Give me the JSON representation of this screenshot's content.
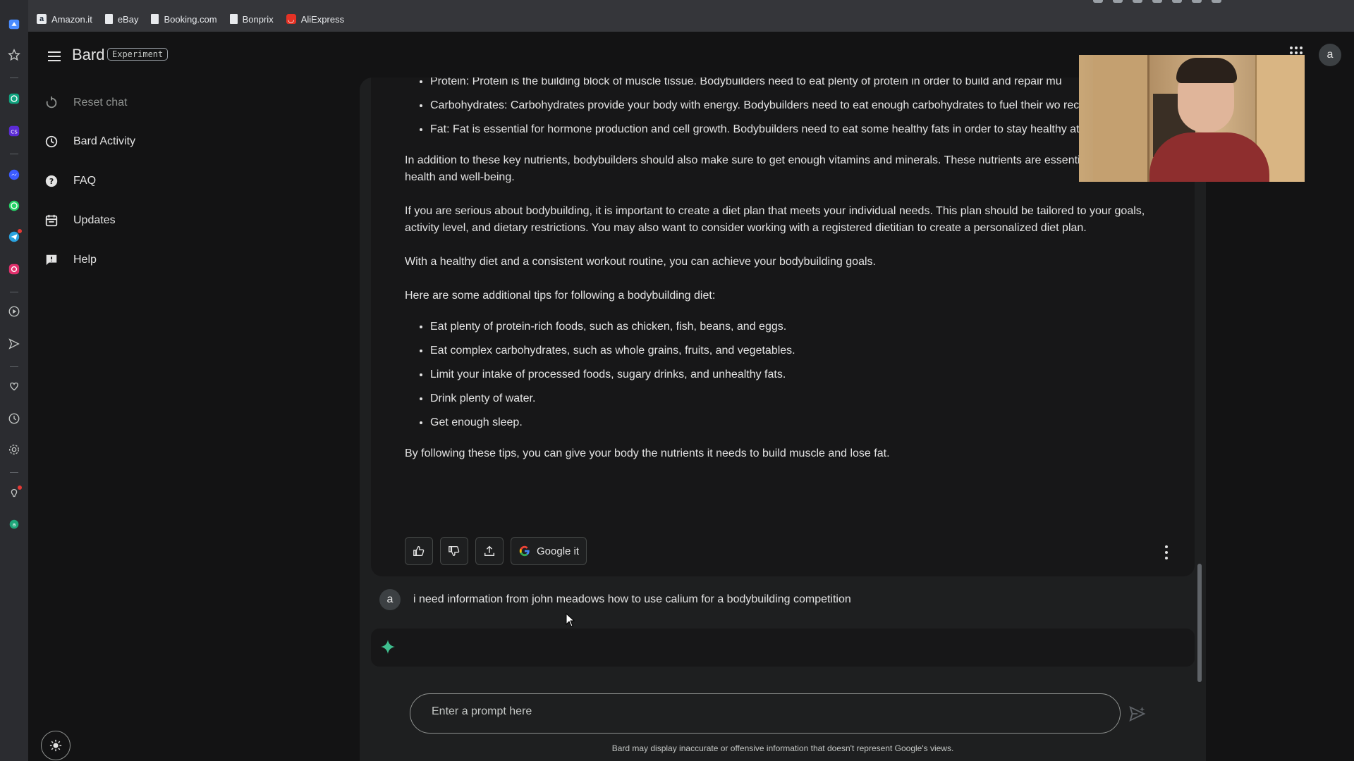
{
  "browser": {
    "bookmarks": [
      {
        "label": "Amazon.it",
        "icon": "amazon-icon"
      },
      {
        "label": "eBay",
        "icon": "page-icon"
      },
      {
        "label": "Booking.com",
        "icon": "page-icon"
      },
      {
        "label": "Bonprix",
        "icon": "page-icon"
      },
      {
        "label": "AliExpress",
        "icon": "aliexpress-icon"
      }
    ],
    "sidebar_icons": [
      "workspace-icon",
      "star-icon",
      "chatgpt-icon",
      "cs-icon",
      "messenger-icon",
      "whatsapp-icon",
      "telegram-icon",
      "instagram-icon",
      "player-icon",
      "send-icon",
      "heart-icon",
      "history-icon",
      "settings-icon",
      "tips-icon",
      "aria-icon"
    ]
  },
  "nav": {
    "logo": "Bard",
    "badge": "Experiment",
    "items": [
      {
        "label": "Reset chat",
        "icon": "reset-icon",
        "disabled": true
      },
      {
        "label": "Bard Activity",
        "icon": "history-icon"
      },
      {
        "label": "FAQ",
        "icon": "help-circle-icon"
      },
      {
        "label": "Updates",
        "icon": "calendar-icon"
      },
      {
        "label": "Help",
        "icon": "feedback-icon"
      }
    ]
  },
  "response": {
    "bullets_top": [
      "Protein: Protein is the building block of muscle tissue. Bodybuilders need to eat plenty of protein in order to build and repair mu",
      "Carbohydrates: Carbohydrates provide your body with energy. Bodybuilders need to eat enough carbohydrates to fuel their wo recover from them.",
      "Fat: Fat is essential for hormone production and cell growth. Bodybuilders need to eat some healthy fats in order to stay healthy at their best."
    ],
    "p1": "In addition to these key nutrients, bodybuilders should also make sure to get enough vitamins and minerals. These nutrients are essential for overall health and well-being.",
    "p2": "If you are serious about bodybuilding, it is important to create a diet plan that meets your individual needs. This plan should be tailored to your goals, activity level, and dietary restrictions. You may also want to consider working with a registered dietitian to create a personalized diet plan.",
    "p3": "With a healthy diet and a consistent workout routine, you can achieve your bodybuilding goals.",
    "p4": "Here are some additional tips for following a bodybuilding diet:",
    "tips": [
      "Eat plenty of protein-rich foods, such as chicken, fish, beans, and eggs.",
      "Eat complex carbohydrates, such as whole grains, fruits, and vegetables.",
      "Limit your intake of processed foods, sugary drinks, and unhealthy fats.",
      "Drink plenty of water.",
      "Get enough sleep."
    ],
    "p5": "By following these tips, you can give your body the nutrients it needs to build muscle and lose fat.",
    "google_it": "Google it"
  },
  "user": {
    "avatar": "a",
    "message": "i need information from john meadows how to use calium for a bodybuilding competition"
  },
  "prompt": {
    "placeholder": "Enter a prompt here",
    "disclaimer": "Bard may display inaccurate or offensive information that doesn't represent Google's views."
  },
  "account": {
    "initial": "a"
  },
  "colors": {
    "background": "#131314",
    "panel": "#1e1f20",
    "accent": "#4285f4"
  }
}
